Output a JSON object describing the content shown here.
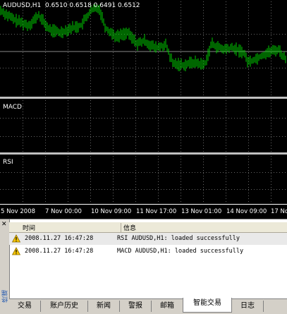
{
  "chart": {
    "main_title": "AUDUSD,H1  0.6510 0.6518 0.6491 0.6512",
    "macd_title": "MACD",
    "rsi_title": "RSI",
    "time_labels": [
      "5 Nov 2008",
      "7 Nov 00:00",
      "10 Nov 09:00",
      "11 Nov 17:00",
      "13 Nov 01:00",
      "14 Nov 09:00",
      "17 No"
    ],
    "colors": {
      "candle": "#00cc00",
      "background": "#000000",
      "grid": "#ffffff"
    }
  },
  "terminal": {
    "side_label": "终端",
    "columns": {
      "time": "时间",
      "info": "信息"
    },
    "rows": [
      {
        "icon": "warning-icon",
        "time": "2008.11.27 16:47:28",
        "message": "RSI AUDUSD,H1: loaded successfully"
      },
      {
        "icon": "warning-icon",
        "time": "2008.11.27 16:47:28",
        "message": "MACD AUDUSD,H1: loaded successfully"
      }
    ],
    "tabs": [
      "交易",
      "账户历史",
      "新闻",
      "警报",
      "邮箱",
      "智能交易",
      "日志"
    ],
    "active_tab": "智能交易"
  }
}
